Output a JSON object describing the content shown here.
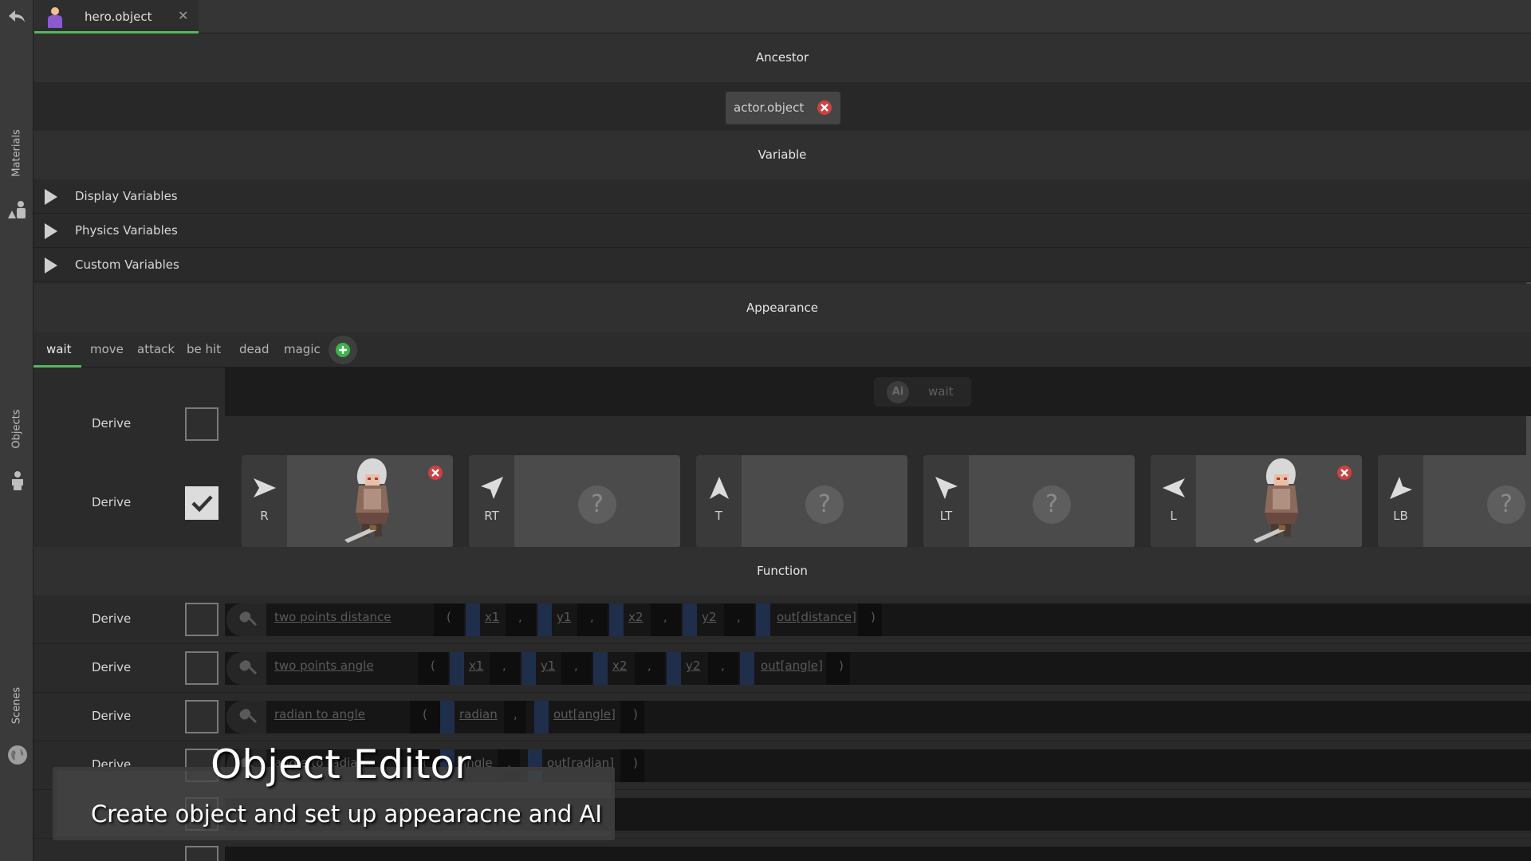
{
  "rail": {
    "labels": [
      "Materials",
      "Objects",
      "Scenes"
    ]
  },
  "tab": {
    "name": "hero.object",
    "close": "✕"
  },
  "sections": {
    "ancestor": "Ancestor",
    "variable": "Variable",
    "appearance": "Appearance",
    "function": "Function"
  },
  "ancestor": {
    "value": "actor.object"
  },
  "variables": [
    {
      "label": "Display  Variables"
    },
    {
      "label": "Physics  Variables"
    },
    {
      "label": "Custom  Variables"
    }
  ],
  "appearance_tabs": [
    "wait",
    "move",
    "attack",
    "be hit",
    "dead",
    "magic"
  ],
  "derive_label": "Derive",
  "ai": {
    "icon_text": "Ai",
    "state": "wait"
  },
  "directions": [
    {
      "label": "R",
      "has_sprite": true
    },
    {
      "label": "RT",
      "has_sprite": false
    },
    {
      "label": "T",
      "has_sprite": false
    },
    {
      "label": "LT",
      "has_sprite": false
    },
    {
      "label": "L",
      "has_sprite": true
    },
    {
      "label": "LB",
      "has_sprite": false
    }
  ],
  "question_mark": "?",
  "functions": [
    {
      "name": "two  points  distance",
      "paren_open": "(",
      "args": [
        "x1",
        ",",
        "y1",
        ",",
        "x2",
        ",",
        "y2",
        ","
      ],
      "out": "out[distance]",
      "paren_close": ")"
    },
    {
      "name": "two  points  angle",
      "paren_open": "(",
      "args": [
        "x1",
        ",",
        "y1",
        ",",
        "x2",
        ",",
        "y2",
        ","
      ],
      "out": "out[angle]",
      "paren_close": ")"
    },
    {
      "name": "radian  to  angle",
      "paren_open": "(",
      "args": [
        "radian",
        ","
      ],
      "out": "out[angle]",
      "paren_close": ")"
    },
    {
      "name": "angle  to  radian",
      "paren_open": "(",
      "args": [
        "angle",
        ","
      ],
      "out": "out[radian]",
      "paren_close": ")"
    }
  ],
  "caption": {
    "title": "Object Editor",
    "subtitle": "Create object and set up appearacne and AI"
  },
  "colors": {
    "accent": "#55b65a",
    "remove": "#d04040",
    "float_tag": "#1f2e4a"
  }
}
